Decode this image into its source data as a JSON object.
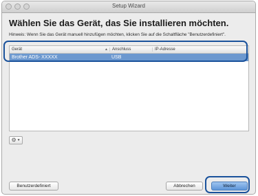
{
  "window": {
    "title": "Setup Wizard"
  },
  "heading": "Wählen Sie das Gerät, das Sie installieren möchten.",
  "hint": "Hinweis: Wenn Sie das Gerät manuell hinzufügen möchten, klicken Sie auf die Schaltfläche \"Benutzerdefiniert\".",
  "table": {
    "columns": [
      "Gerät",
      "Anschluss",
      "IP-Adresse"
    ],
    "rows": [
      {
        "device": "Brother ADS- XXXXX",
        "connection": "USB",
        "ip": ""
      }
    ]
  },
  "buttons": {
    "custom": "Benutzerdefiniert",
    "cancel": "Abbrechen",
    "next": "Weiter"
  },
  "colors": {
    "selection": "#6c98cf",
    "callout": "#19519b",
    "default_button": "#5d95d8"
  }
}
